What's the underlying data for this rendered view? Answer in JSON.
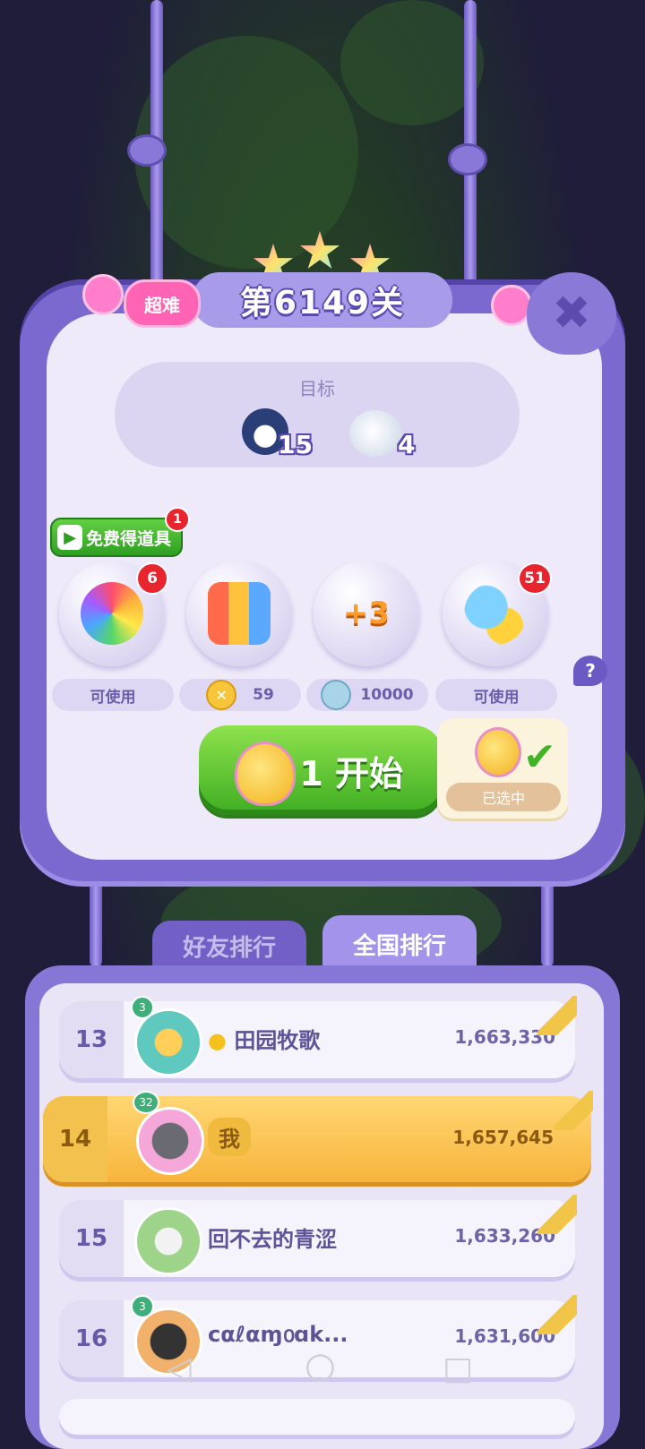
{
  "level": {
    "title": "第6149关",
    "difficulty": "超难",
    "stars": 3
  },
  "goal": {
    "label": "目标",
    "items": [
      {
        "icon": "penguin-icon",
        "count": "15"
      },
      {
        "icon": "seal-icon",
        "count": "4"
      }
    ]
  },
  "free_props": {
    "label": "免费得道具",
    "badge": "1"
  },
  "boosters": [
    {
      "icon": "rainbow-owl-icon",
      "badge": "6",
      "status": "可使用"
    },
    {
      "icon": "rockets-icon",
      "badge": "",
      "status": "59",
      "currency": "gold-coin-icon"
    },
    {
      "icon": "plus3-moves-icon",
      "badge": "",
      "status": "10000",
      "currency": "silver-coin-icon",
      "text": "+3"
    },
    {
      "icon": "hippo-chick-icon",
      "badge": "51",
      "status": "可使用"
    }
  ],
  "start": {
    "label": "1 开始",
    "selected_tag": "已选中"
  },
  "help_icon": "?",
  "close_icon": "✖",
  "tabs": {
    "friends": "好友排行",
    "national": "全国排行",
    "active": "national"
  },
  "ranking": [
    {
      "rank": "13",
      "name": "田园牧歌",
      "score": "1,663,330",
      "level": "3",
      "me": false
    },
    {
      "rank": "14",
      "name": "我",
      "score": "1,657,645",
      "level": "32",
      "me": true
    },
    {
      "rank": "15",
      "name": "回不去的青涩",
      "score": "1,633,260",
      "level": "",
      "me": false
    },
    {
      "rank": "16",
      "name": "cαℓαɱ൦ɑk...",
      "score": "1,631,600",
      "level": "3",
      "me": false
    }
  ],
  "navbar": {
    "back": "◁",
    "home": "○",
    "recents": "□"
  },
  "colors": {
    "panel": "#7b69cf",
    "start_green": "#3ead22",
    "highlight_row": "#f7b43c",
    "badge_red": "#e8242f"
  }
}
